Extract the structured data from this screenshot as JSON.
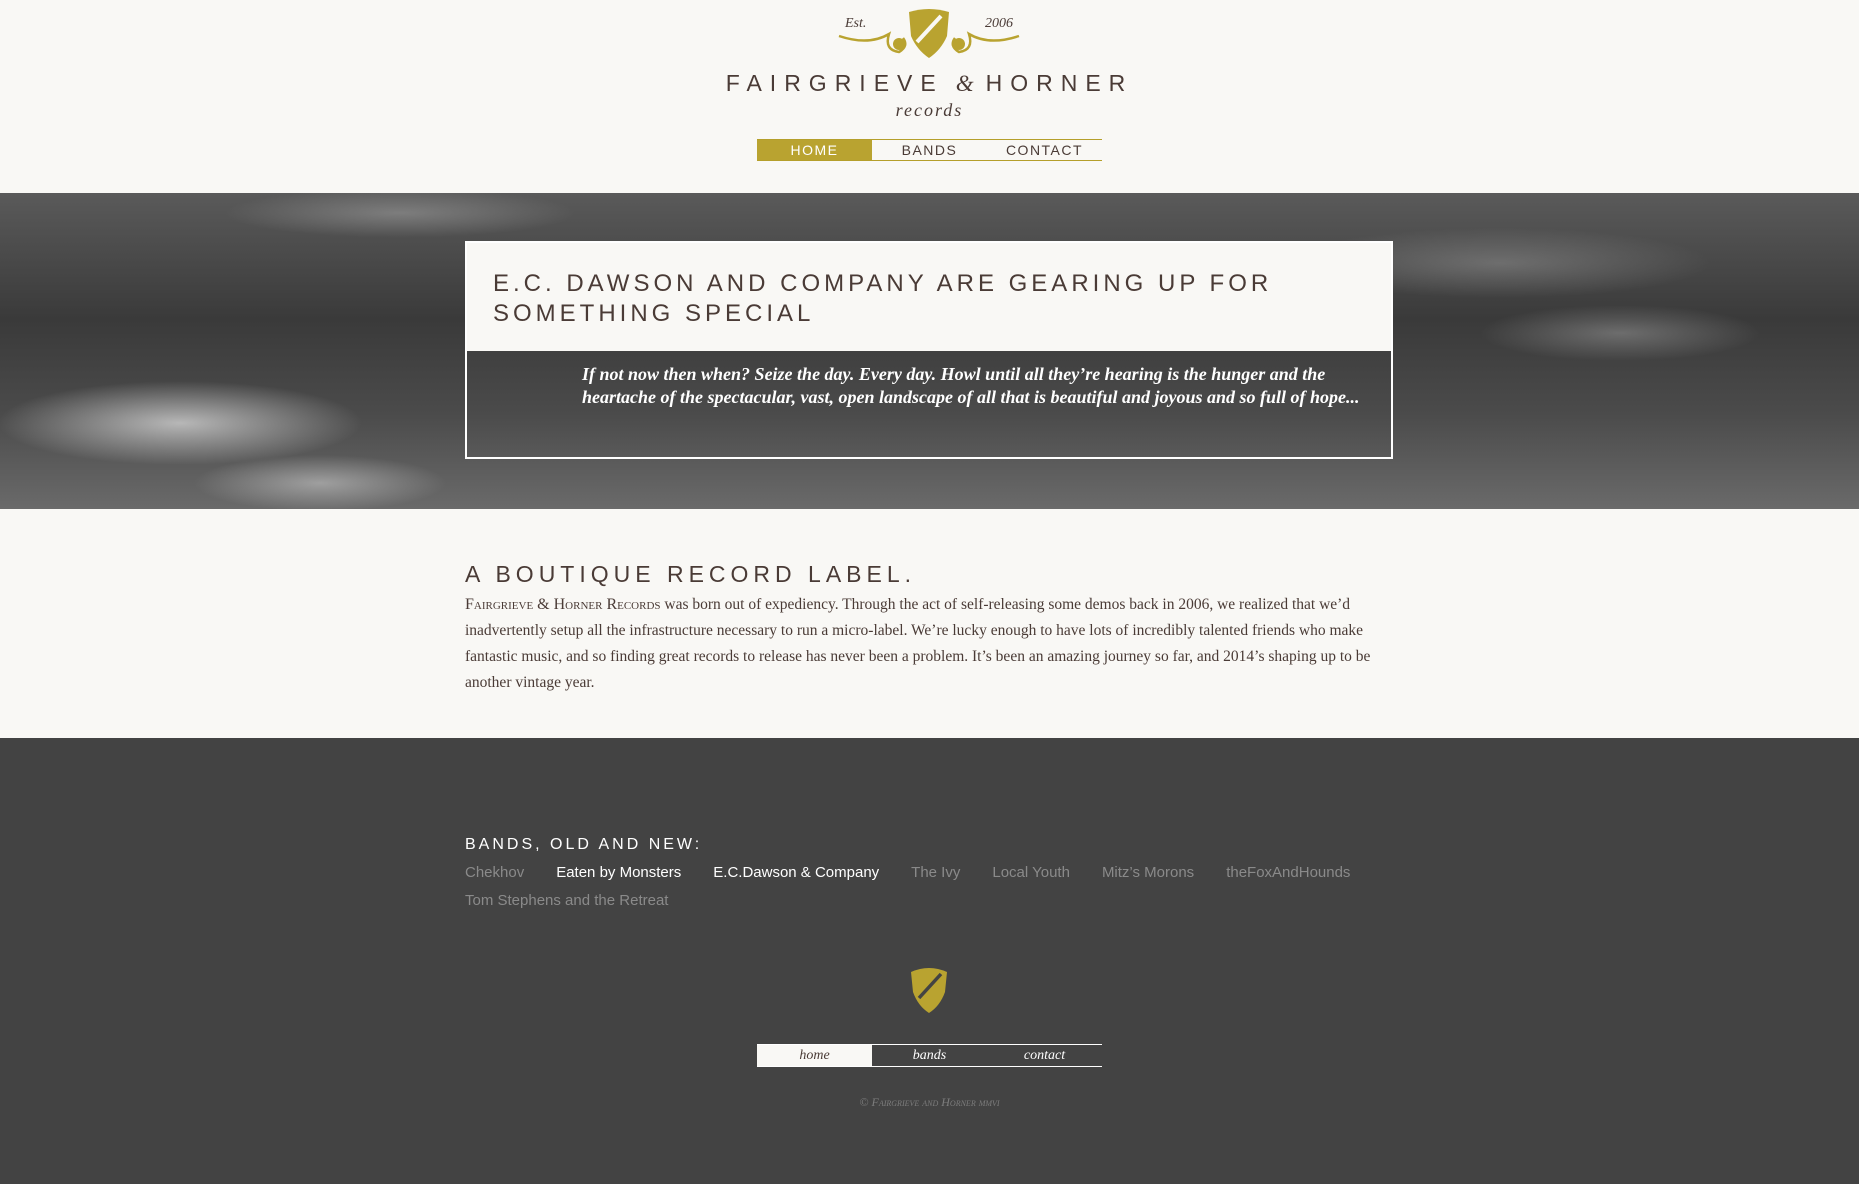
{
  "header": {
    "est_left": "Est.",
    "est_right": "2006",
    "brand_left": "FAIRGRIEVE",
    "brand_amp": "&",
    "brand_right": "HORNER",
    "sub_brand": "records",
    "nav": [
      {
        "label": "HOME",
        "active": true
      },
      {
        "label": "BANDS",
        "active": false
      },
      {
        "label": "CONTACT",
        "active": false
      }
    ]
  },
  "hero": {
    "title": "E.C. Dawson and Company are gearing up for something special",
    "quote": "If not now then when? Seize the day. Every day. Howl until all they’re hearing is the hunger and the heartache of the spectacular, vast, open landscape of all that is beautiful and joyous and so full of hope..."
  },
  "about": {
    "title": "A boutique record label.",
    "lead": "Fairgrieve & Horner Records",
    "body": " was born out of expediency. Through the act of self-releasing some demos back in 2006, we realized that we’d inadvertently setup all the infrastructure necessary to run a micro-label. We’re lucky enough to have lots of incredibly talented friends who make fantastic music, and so finding great records to release has never been a problem. It’s been an amazing journey so far, and 2014’s shaping up to be another vintage year."
  },
  "footer": {
    "bands_title": "Bands, old and new:",
    "bands": [
      {
        "name": "Chekhov",
        "bright": false
      },
      {
        "name": "Eaten by Monsters",
        "bright": true
      },
      {
        "name": "E.C.Dawson & Company",
        "bright": true
      },
      {
        "name": "The Ivy",
        "bright": false
      },
      {
        "name": "Local Youth",
        "bright": false
      },
      {
        "name": "Mitz’s Morons",
        "bright": false
      },
      {
        "name": "theFoxAndHounds",
        "bright": false
      },
      {
        "name": "Tom Stephens and the Retreat",
        "bright": false
      }
    ],
    "nav": [
      {
        "label": "home",
        "active": true
      },
      {
        "label": "bands",
        "active": false
      },
      {
        "label": "contact",
        "active": false
      }
    ],
    "copyright": "© Fairgrieve and Horner mmvi"
  },
  "colors": {
    "accent_gold": "#b9a330",
    "text_brown": "#4a3b36",
    "footer_bg": "#434343",
    "page_bg": "#f9f8f5"
  },
  "icons": {
    "crest": "shield-crest-icon",
    "footer_shield": "shield-icon"
  }
}
